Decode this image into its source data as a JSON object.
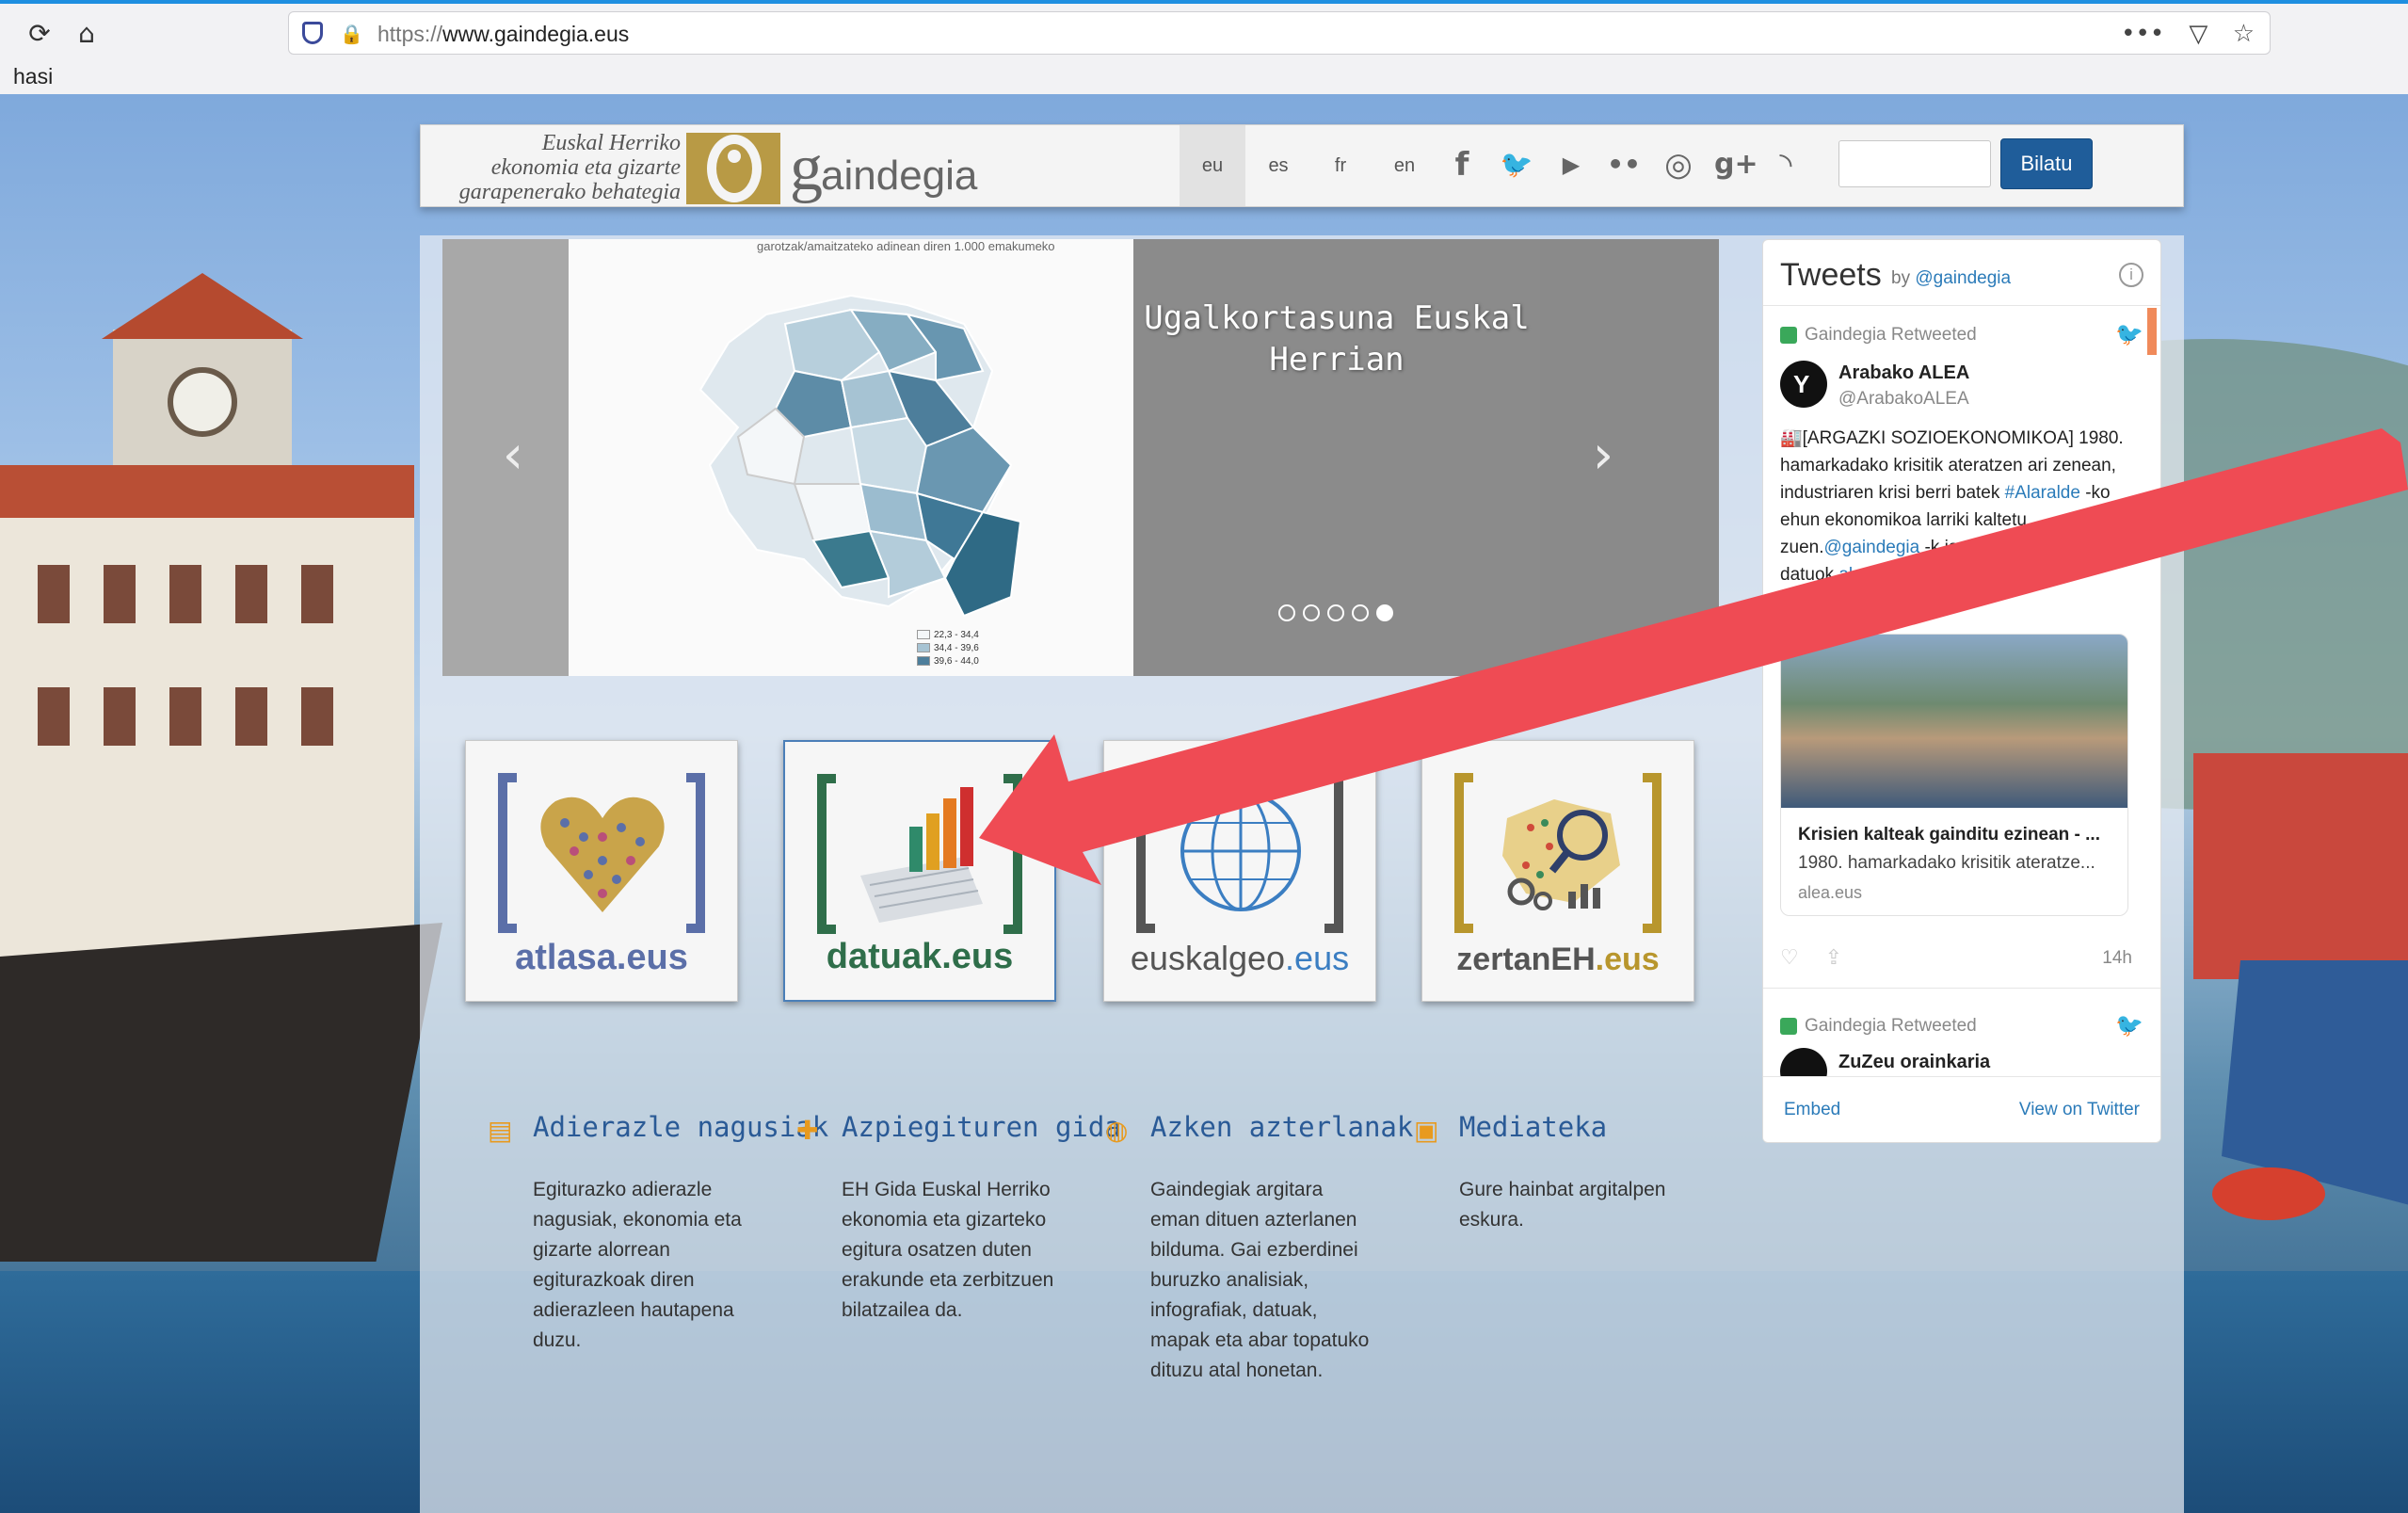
{
  "browser": {
    "url_protocol": "https://",
    "url_host": "www.gaindegia.eus",
    "bookmark": "hasi",
    "reload_glyph": "⟳",
    "home_glyph": "⌂",
    "more_glyph": "•••",
    "pocket_glyph": "▽",
    "star_glyph": "☆",
    "lock_glyph": "🔒"
  },
  "header": {
    "brand_lines": [
      "Euskal Herriko",
      "ekonomia eta gizarte",
      "garapenerako behategia"
    ],
    "logo_g": "g",
    "logo_rest": "aindegia",
    "languages": [
      "eu",
      "es",
      "fr",
      "en"
    ],
    "active_language": "eu",
    "social_icons": [
      {
        "name": "facebook-icon",
        "glyph": "f"
      },
      {
        "name": "twitter-icon",
        "glyph": "🐦"
      },
      {
        "name": "youtube-icon",
        "glyph": "▶"
      },
      {
        "name": "flickr-icon",
        "glyph": "••"
      },
      {
        "name": "instagram-icon",
        "glyph": "◎"
      },
      {
        "name": "googleplus-icon",
        "glyph": "g+"
      },
      {
        "name": "rss-icon",
        "glyph": "◝"
      }
    ],
    "search_button": "Bilatu",
    "search_placeholder": ""
  },
  "carousel": {
    "map_title": "garotzak/amaitzateko adinean diren 1.000 emakumeko",
    "caption": "Ugalkortasuna Euskal Herrian",
    "prev_glyph": "‹",
    "next_glyph": "›",
    "slide_count": 5,
    "active_slide": 5,
    "legend": [
      "22,3 - 34,4",
      "34,4 - 39,6",
      "39,6 - 44,0"
    ]
  },
  "tiles": [
    {
      "name": "atlasa-tile",
      "label": "atlasa.eus",
      "color": "#5b6fa8",
      "bracket": "#5b6fa8"
    },
    {
      "name": "datuak-tile",
      "label": "datuak.eus",
      "color": "#2f6e4a",
      "bracket": "#2f6e4a"
    },
    {
      "name": "euskalgeo-tile",
      "label_main": "euskalgeo",
      "label_suffix": ".eus",
      "color": "#555555",
      "bracket": "#555555"
    },
    {
      "name": "zertaneh-tile",
      "label_main": "zertanEH",
      "label_suffix": ".eus",
      "color": "#b8962d",
      "bracket": "#b8962d"
    }
  ],
  "features": [
    {
      "title": "Adierazle nagusiak",
      "icon": "clipboard-icon",
      "glyph": "▤",
      "text": "Egiturazko adierazle nagusiak, ekonomia eta gizarte alorrean egiturazkoak diren adierazleen hautapena duzu."
    },
    {
      "title": "Azpiegituren gida",
      "icon": "puzzle-icon",
      "glyph": "✚",
      "text": "EH Gida Euskal Herriko ekonomia eta gizarteko egitura osatzen duten erakunde eta zerbitzuen bilatzailea da."
    },
    {
      "title": "Azken azterlanak",
      "icon": "globe-icon",
      "glyph": "◍",
      "text": "Gaindegiak argitara eman dituen azterlanen bilduma. Gai ezberdinei buruzko analisiak, infografiak, datuak, mapak eta abar topatuko dituzu atal honetan."
    },
    {
      "title": "Mediateka",
      "icon": "briefcase-icon",
      "glyph": "▣",
      "text": "Gure hainbat argitalpen eskura."
    }
  ],
  "twitter": {
    "title": "Tweets",
    "by": "by",
    "handle": "@gaindegia",
    "info": "i",
    "retweeted": "Gaindegia Retweeted",
    "bird": "🐦",
    "tweet1": {
      "name": "Arabako ALEA",
      "handle": "@ArabakoALEA",
      "text_1": "🏭[ARGAZKI SOZIOEKONOMIKOA] 1980. hamarkadako krisitik ateratzen ari zenean, industriaren krisi berri batek ",
      "hashtag": "#Alaralde",
      "text_2": " -ko ehun ekonomikoa larriki kaltetu zuen.",
      "mention": "@gaindegia",
      "text_3": " -k jaso ditu datuok.",
      "link": "alea.eus/alar...",
      "card_title": "Krisien kalteak gainditu ezinean - ...",
      "card_desc": "1980. hamarkadako krisitik ateratze...",
      "card_url": "alea.eus",
      "time": "14h",
      "like_glyph": "♡",
      "share_glyph": "⇪"
    },
    "tweet2": {
      "name": "ZuZeu orainkaria"
    },
    "embed": "Embed",
    "view_on": "View on Twitter"
  }
}
